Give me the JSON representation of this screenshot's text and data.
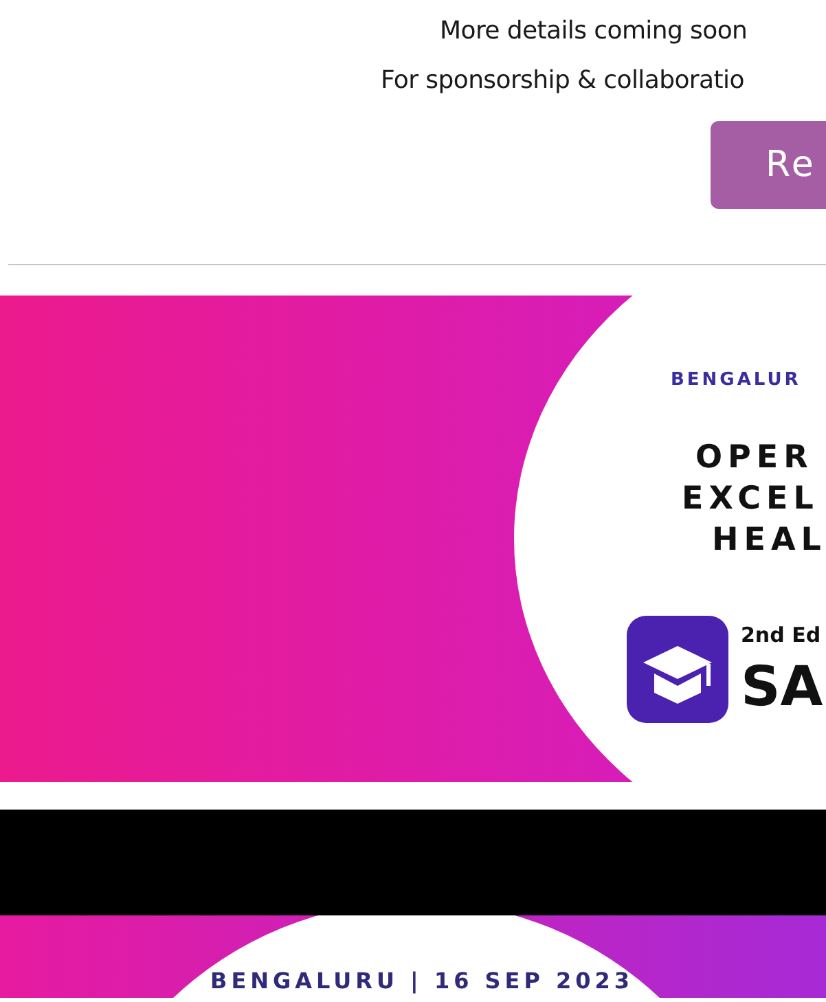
{
  "info_lines": [
    "More details coming soon",
    "For sponsorship & collaboratio"
  ],
  "register_button": {
    "label": "Re"
  },
  "banners": [
    {
      "kind": "title",
      "location": "BENGALUR",
      "title_lines": [
        "OPER",
        "EXCEL",
        "HEAL"
      ],
      "edition": "2nd Ed",
      "brand": "SA"
    },
    {
      "kind": "video",
      "location": "BENGALURU | 16 SEP 2023"
    }
  ]
}
